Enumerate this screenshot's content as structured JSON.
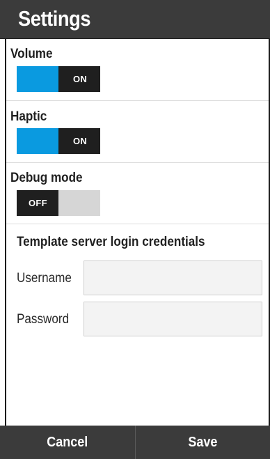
{
  "header": {
    "title": "Settings"
  },
  "settings": [
    {
      "label": "Volume",
      "state": "ON",
      "on": true
    },
    {
      "label": "Haptic",
      "state": "ON",
      "on": true
    },
    {
      "label": "Debug mode",
      "state": "OFF",
      "on": false
    }
  ],
  "credentials": {
    "title": "Template server login credentials",
    "username": {
      "label": "Username",
      "value": ""
    },
    "password": {
      "label": "Password",
      "value": ""
    }
  },
  "footer": {
    "cancel": "Cancel",
    "save": "Save"
  },
  "colors": {
    "accent": "#0a9ae0",
    "bar": "#3b3b3b",
    "toggle_dark": "#1f1f1f",
    "toggle_off": "#d6d6d6"
  }
}
